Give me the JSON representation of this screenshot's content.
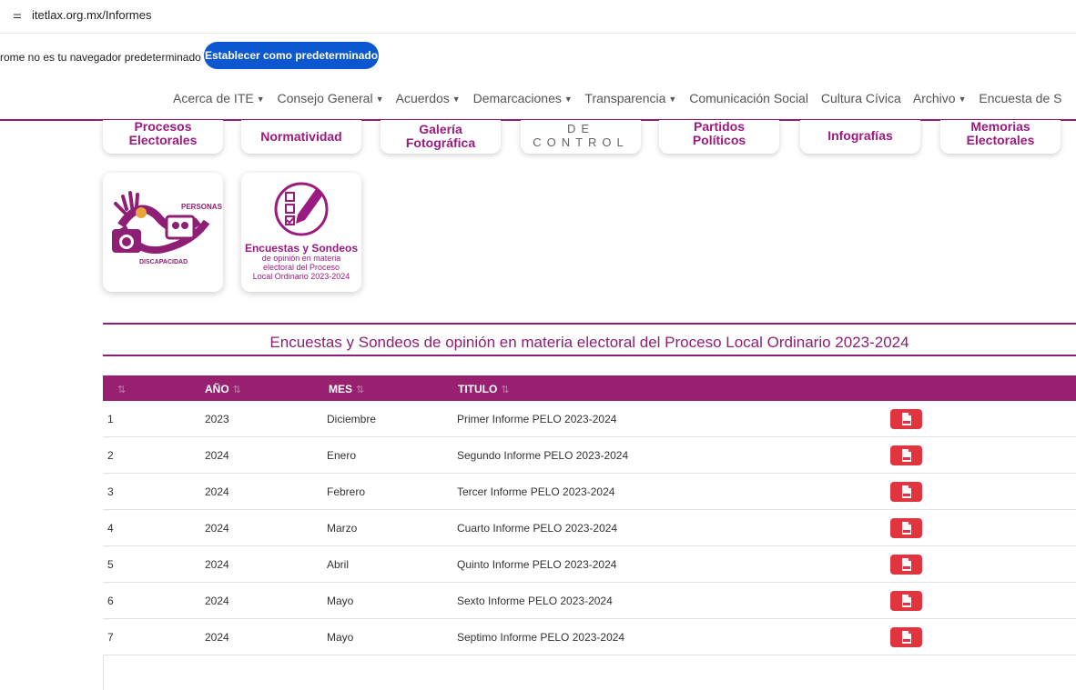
{
  "browser": {
    "url": "itetlax.org.mx/Informes",
    "default_msg": "rome no es tu navegador predeterminado",
    "default_btn": "Establecer como predeterminado"
  },
  "nav": {
    "items": [
      "Acerca de ITE",
      "Consejo General",
      "Acuerdos",
      "Demarcaciones",
      "Transparencia",
      "Comunicación Social",
      "Cultura Cívica",
      "Archivo",
      "Encuesta de S"
    ]
  },
  "top_cards": [
    {
      "l1": "Procesos",
      "l2": "Electorales"
    },
    {
      "l1": "Normatividad",
      "l2": ""
    },
    {
      "l1": "Galería",
      "l2": "Fotográfica"
    },
    {
      "l1": "DE CONTROL",
      "l2": ""
    },
    {
      "l1": "Partidos",
      "l2": "Políticos"
    },
    {
      "l1": "Infografías",
      "l2": ""
    },
    {
      "l1": "Memorias",
      "l2": "Electorales"
    }
  ],
  "cards": {
    "disability_text": "PERSONAS CON DISCAPACIDAD",
    "encuestas_title": "Encuestas y Sondeos",
    "encuestas_l1": "de opinión en materia",
    "encuestas_l2": "electoral del Proceso",
    "encuestas_l3": "Local Ordinario 2023-2024"
  },
  "section_title": "Encuestas y Sondeos de opinión en materia electoral del Proceso Local Ordinario 2023-2024",
  "table": {
    "headers": {
      "num": "",
      "year": "AÑO",
      "month": "MES",
      "title": "TITULO"
    },
    "rows": [
      {
        "n": "1",
        "year": "2023",
        "month": "Diciembre",
        "title": "Primer Informe PELO 2023-2024"
      },
      {
        "n": "2",
        "year": "2024",
        "month": "Enero",
        "title": "Segundo Informe PELO 2023-2024"
      },
      {
        "n": "3",
        "year": "2024",
        "month": "Febrero",
        "title": "Tercer Informe PELO 2023-2024"
      },
      {
        "n": "4",
        "year": "2024",
        "month": "Marzo",
        "title": "Cuarto Informe PELO 2023-2024"
      },
      {
        "n": "5",
        "year": "2024",
        "month": "Abril",
        "title": "Quinto Informe PELO 2023-2024"
      },
      {
        "n": "6",
        "year": "2024",
        "month": "Mayo",
        "title": "Sexto Informe PELO 2023-2024"
      },
      {
        "n": "7",
        "year": "2024",
        "month": "Mayo",
        "title": "Septimo Informe PELO 2023-2024"
      }
    ]
  },
  "colors": {
    "brand": "#982071",
    "pdf": "#e0353f",
    "chrome_button": "#0b57d0"
  },
  "icons": [
    "site-settings-icon",
    "caret-down-icon",
    "sort-icon",
    "pdf-icon",
    "disability-logo",
    "survey-logo"
  ]
}
